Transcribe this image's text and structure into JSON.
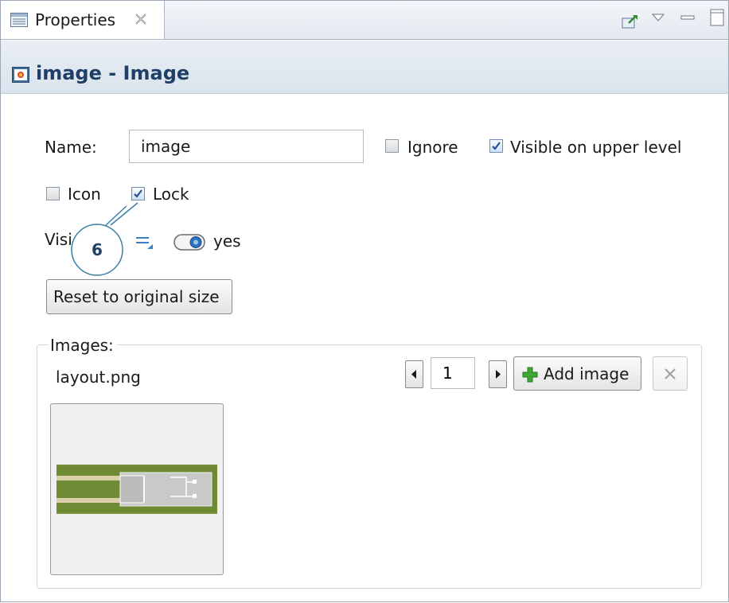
{
  "tab": {
    "title": "Properties",
    "close_glyph": "✕"
  },
  "view_toolbar": {
    "icons": [
      "pin-icon",
      "view-menu-icon",
      "minimize-icon",
      "maximize-icon"
    ]
  },
  "header": {
    "title": "image - Image"
  },
  "form": {
    "name_label": "Name:",
    "name_value": "image",
    "ignore_label": "Ignore",
    "ignore_checked": false,
    "visible_upper_label": "Visible on upper level",
    "visible_upper_checked": true,
    "icon_label": "Icon",
    "icon_checked": false,
    "lock_label": "Lock",
    "lock_checked": true,
    "visible_label": "Visi",
    "visible_value": "yes",
    "reset_button": "Reset to original size"
  },
  "callout": {
    "number": "6"
  },
  "images": {
    "group_label": "Images:",
    "file_name": "layout.png",
    "page": "1",
    "add_button": "Add image"
  },
  "colors": {
    "header_text": "#1e3f66",
    "callout": "#3a7fa8",
    "add_green": "#3fa535"
  }
}
